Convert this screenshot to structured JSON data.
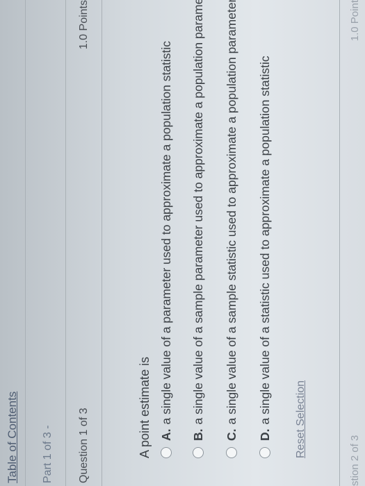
{
  "nav": {
    "toc_label": "Table of Contents",
    "part_label": "Part 1 of 3 -",
    "question_label": "Question 1 of 3",
    "points_label": "1.0 Points"
  },
  "question": {
    "prompt": "A point estimate is",
    "options": [
      {
        "letter": "A.",
        "text": "a single value of a parameter used to approximate a population statistic"
      },
      {
        "letter": "B.",
        "text": "a single value of a sample parameter used to approximate a population parameter"
      },
      {
        "letter": "C.",
        "text": "a single value of a sample statistic used to approximate a population parameter"
      },
      {
        "letter": "D.",
        "text": "a single value of a statistic used to approximate a population statistic"
      }
    ],
    "reset_label": "Reset Selection"
  },
  "next": {
    "question_label": "stion 2 of 3",
    "points_label": "1.0 Point"
  }
}
